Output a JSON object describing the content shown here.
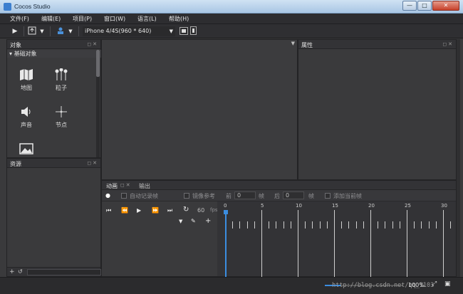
{
  "window": {
    "title": "Cocos Studio",
    "min": "—",
    "max": "□",
    "close": "✕"
  },
  "menu": [
    "文件(F)",
    "编辑(E)",
    "项目(P)",
    "窗口(W)",
    "语言(L)",
    "帮助(H)"
  ],
  "toolbar": {
    "play": "▶",
    "dropdown_arrow": "▼",
    "device": "iPhone 4/4S(960 * 640)"
  },
  "objects_panel": {
    "title": "对象",
    "group": "基础对象",
    "items": [
      {
        "label": "地图",
        "icon": "map-icon"
      },
      {
        "label": "粒子",
        "icon": "particle-icon"
      },
      {
        "label": "声音",
        "icon": "sound-icon"
      },
      {
        "label": "节点",
        "icon": "node-icon"
      },
      {
        "label": "",
        "icon": "image-icon"
      }
    ]
  },
  "resources_panel": {
    "title": "资源",
    "add": "+",
    "refresh": "↺"
  },
  "properties_panel": {
    "title": "属性"
  },
  "timeline": {
    "tabs": [
      "动画",
      "输出"
    ],
    "auto_keyframe": "自动记录帧",
    "onion_skin": "镜像参考",
    "before_label": "前",
    "before_value": "0",
    "frame_label": "帧",
    "after_label": "后",
    "after_value": "0",
    "frame_label2": "帧",
    "add_keyframe": "添加当前帧",
    "fps_value": "60",
    "fps_label": "fps",
    "ruler": [
      "0",
      "5",
      "10",
      "15",
      "20",
      "25",
      "30"
    ]
  },
  "status": {
    "zoom": "100%",
    "watermark": "http://blog.csdn.net/qq_1103"
  },
  "colors": {
    "accent": "#3b8de0",
    "panel": "#3a3a3c",
    "dark": "#2b2b2d"
  }
}
